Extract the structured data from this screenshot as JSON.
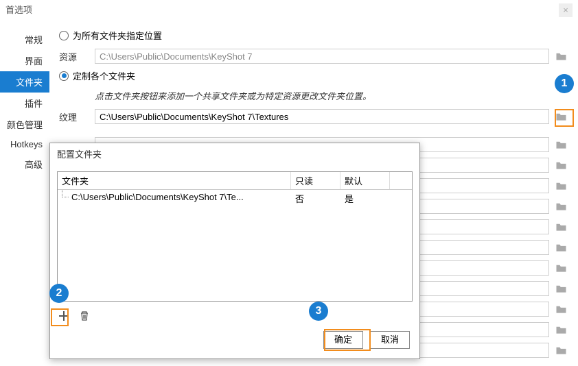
{
  "window": {
    "title": "首选项"
  },
  "sidebar": {
    "items": [
      {
        "label": "常规"
      },
      {
        "label": "界面"
      },
      {
        "label": "文件夹"
      },
      {
        "label": "插件"
      },
      {
        "label": "颜色管理"
      },
      {
        "label": "Hotkeys"
      },
      {
        "label": "高级"
      }
    ]
  },
  "folders": {
    "radio_all_label": "为所有文件夹指定位置",
    "resource_label": "资源",
    "resource_path": "C:\\Users\\Public\\Documents\\KeyShot 7",
    "radio_custom_label": "定制各个文件夹",
    "hint": "点击文件夹按钮来添加一个共享文件夹或为特定资源更改文件夹位置。",
    "texture_label": "纹理",
    "texture_path": "C:\\Users\\Public\\Documents\\KeyShot 7\\Textures"
  },
  "dialog": {
    "title": "配置文件夹",
    "headers": {
      "folder": "文件夹",
      "readonly": "只读",
      "default": "默认"
    },
    "rows": [
      {
        "path": "C:\\Users\\Public\\Documents\\KeyShot 7\\Te...",
        "readonly": "否",
        "default": "是"
      }
    ],
    "ok": "确定",
    "cancel": "取消"
  },
  "badges": {
    "one": "1",
    "two": "2",
    "three": "3"
  }
}
